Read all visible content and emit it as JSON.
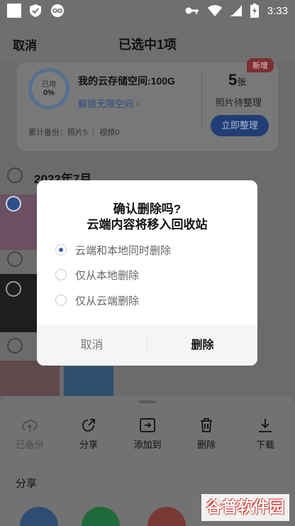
{
  "status_bar": {
    "time": "3:33"
  },
  "header": {
    "cancel_label": "取消",
    "title": "已选中1项"
  },
  "storage": {
    "ring_label": "已用",
    "ring_percent": "0%",
    "title": "我的云存储空间:100G",
    "unlock_link": "解锁无限空间 ›",
    "new_badge": "新增",
    "pending_count": "5",
    "pending_unit": "张",
    "pending_label": "照片待整理",
    "organize_button": "立即整理",
    "backup_stats": "累计备份：照片5 ｜ 视频0"
  },
  "gallery": {
    "month_label": "2022年7月"
  },
  "dialog": {
    "title_line1": "确认删除吗?",
    "title_line2": "云端内容将移入回收站",
    "options": [
      {
        "label": "云端和本地同时删除",
        "selected": true
      },
      {
        "label": "仅从本地删除",
        "selected": false
      },
      {
        "label": "仅从云端删除",
        "selected": false
      }
    ],
    "cancel_label": "取消",
    "delete_label": "删除"
  },
  "actions": [
    {
      "label": "已备份",
      "icon": "cloud-upload-icon",
      "enabled": false
    },
    {
      "label": "分享",
      "icon": "share-icon",
      "enabled": true
    },
    {
      "label": "添加到",
      "icon": "folder-add-icon",
      "enabled": true
    },
    {
      "label": "删除",
      "icon": "trash-icon",
      "enabled": true
    },
    {
      "label": "下载",
      "icon": "download-icon",
      "enabled": true
    }
  ],
  "share_section": {
    "title": "分享"
  },
  "watermark": {
    "text": "谷普软件园"
  },
  "colors": {
    "accent": "#3e63b5",
    "badge": "#7b2f33",
    "organize_button": "#203e74"
  }
}
